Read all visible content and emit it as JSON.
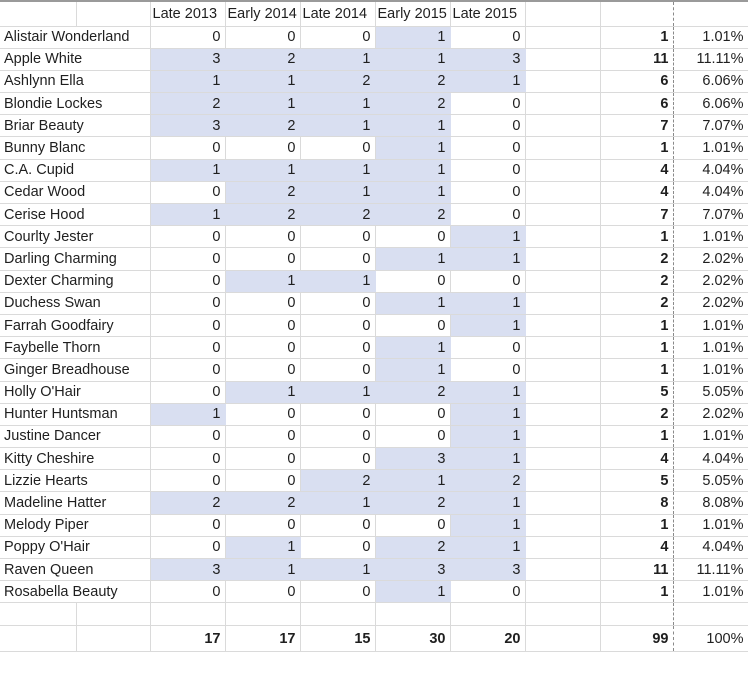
{
  "sheet": {
    "headers": {
      "name": "",
      "periods": [
        "Late 2013",
        "Early 2014",
        "Late 2014",
        "Early 2015",
        "Late 2015"
      ],
      "blank": "",
      "total": "",
      "percent": ""
    },
    "highlight_color": "#d9dff1",
    "rows": [
      {
        "name": "Alistair Wonderland",
        "values": [
          "0",
          "0",
          "0",
          "1",
          "0"
        ],
        "total": "1",
        "percent": "1.01%"
      },
      {
        "name": "Apple White",
        "values": [
          "3",
          "2",
          "1",
          "1",
          "3"
        ],
        "total": "11",
        "percent": "11.11%"
      },
      {
        "name": "Ashlynn Ella",
        "values": [
          "1",
          "1",
          "2",
          "2",
          "1"
        ],
        "total": "6",
        "percent": "6.06%"
      },
      {
        "name": "Blondie Lockes",
        "values": [
          "2",
          "1",
          "1",
          "2",
          "0"
        ],
        "total": "6",
        "percent": "6.06%"
      },
      {
        "name": "Briar Beauty",
        "values": [
          "3",
          "2",
          "1",
          "1",
          "0"
        ],
        "total": "7",
        "percent": "7.07%"
      },
      {
        "name": "Bunny Blanc",
        "values": [
          "0",
          "0",
          "0",
          "1",
          "0"
        ],
        "total": "1",
        "percent": "1.01%"
      },
      {
        "name": "C.A. Cupid",
        "values": [
          "1",
          "1",
          "1",
          "1",
          "0"
        ],
        "total": "4",
        "percent": "4.04%"
      },
      {
        "name": "Cedar Wood",
        "values": [
          "0",
          "2",
          "1",
          "1",
          "0"
        ],
        "total": "4",
        "percent": "4.04%"
      },
      {
        "name": "Cerise Hood",
        "values": [
          "1",
          "2",
          "2",
          "2",
          "0"
        ],
        "total": "7",
        "percent": "7.07%"
      },
      {
        "name": "Courlty Jester",
        "values": [
          "0",
          "0",
          "0",
          "0",
          "1"
        ],
        "total": "1",
        "percent": "1.01%"
      },
      {
        "name": "Darling Charming",
        "values": [
          "0",
          "0",
          "0",
          "1",
          "1"
        ],
        "total": "2",
        "percent": "2.02%"
      },
      {
        "name": "Dexter Charming",
        "values": [
          "0",
          "1",
          "1",
          "0",
          "0"
        ],
        "total": "2",
        "percent": "2.02%"
      },
      {
        "name": "Duchess Swan",
        "values": [
          "0",
          "0",
          "0",
          "1",
          "1"
        ],
        "total": "2",
        "percent": "2.02%"
      },
      {
        "name": "Farrah Goodfairy",
        "values": [
          "0",
          "0",
          "0",
          "0",
          "1"
        ],
        "total": "1",
        "percent": "1.01%"
      },
      {
        "name": "Faybelle Thorn",
        "values": [
          "0",
          "0",
          "0",
          "1",
          "0"
        ],
        "total": "1",
        "percent": "1.01%"
      },
      {
        "name": "Ginger Breadhouse",
        "values": [
          "0",
          "0",
          "0",
          "1",
          "0"
        ],
        "total": "1",
        "percent": "1.01%"
      },
      {
        "name": "Holly O'Hair",
        "values": [
          "0",
          "1",
          "1",
          "2",
          "1"
        ],
        "total": "5",
        "percent": "5.05%"
      },
      {
        "name": "Hunter Huntsman",
        "values": [
          "1",
          "0",
          "0",
          "0",
          "1"
        ],
        "total": "2",
        "percent": "2.02%"
      },
      {
        "name": "Justine Dancer",
        "values": [
          "0",
          "0",
          "0",
          "0",
          "1"
        ],
        "total": "1",
        "percent": "1.01%"
      },
      {
        "name": "Kitty Cheshire",
        "values": [
          "0",
          "0",
          "0",
          "3",
          "1"
        ],
        "total": "4",
        "percent": "4.04%"
      },
      {
        "name": "Lizzie Hearts",
        "values": [
          "0",
          "0",
          "2",
          "1",
          "2"
        ],
        "total": "5",
        "percent": "5.05%"
      },
      {
        "name": "Madeline Hatter",
        "values": [
          "2",
          "2",
          "1",
          "2",
          "1"
        ],
        "total": "8",
        "percent": "8.08%"
      },
      {
        "name": "Melody Piper",
        "values": [
          "0",
          "0",
          "0",
          "0",
          "1"
        ],
        "total": "1",
        "percent": "1.01%"
      },
      {
        "name": "Poppy O'Hair",
        "values": [
          "0",
          "1",
          "0",
          "2",
          "1"
        ],
        "total": "4",
        "percent": "4.04%"
      },
      {
        "name": "Raven Queen",
        "values": [
          "3",
          "1",
          "1",
          "3",
          "3"
        ],
        "total": "11",
        "percent": "11.11%"
      },
      {
        "name": "Rosabella Beauty",
        "values": [
          "0",
          "0",
          "0",
          "1",
          "0"
        ],
        "total": "1",
        "percent": "1.01%"
      }
    ],
    "totals": {
      "periods": [
        "17",
        "17",
        "15",
        "30",
        "20"
      ],
      "grand_total": "99",
      "grand_percent": "100%"
    }
  }
}
